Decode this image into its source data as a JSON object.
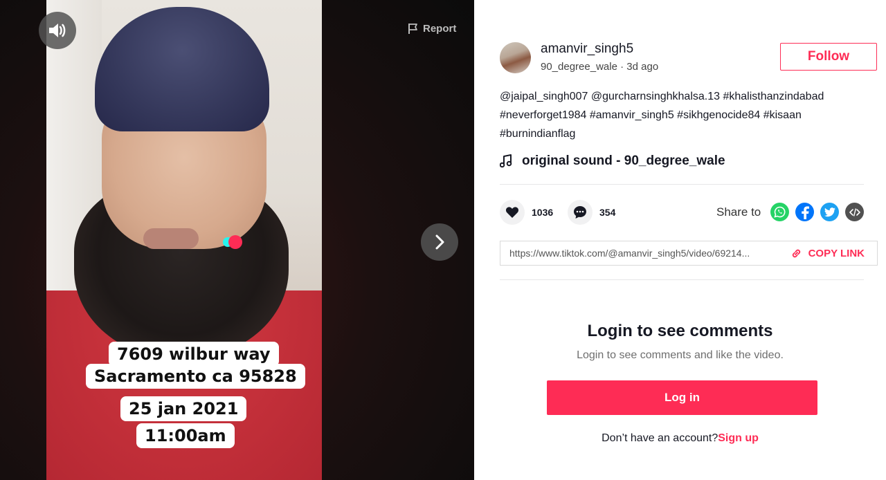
{
  "video": {
    "report_label": "Report",
    "overlay_lines": [
      "7609 wilbur way",
      "Sacramento ca 95828",
      "25 jan 2021",
      "11:00am"
    ]
  },
  "author": {
    "username": "amanvir_singh5",
    "nickname": "90_degree_wale",
    "separator": " · ",
    "posted": "3d ago"
  },
  "follow_label": "Follow",
  "description_lines": [
    "@jaipal_singh007 @gurcharnsinghkhalsa.13 #khalisthanzindabad",
    "#neverforget1984 #amanvir_singh5 #sikhgenocide84 #kisaan",
    "#burnindianflag"
  ],
  "music": "original sound - 90_degree_wale",
  "stats": {
    "likes": "1036",
    "comments": "354"
  },
  "share": {
    "label": "Share to",
    "icons": [
      "whatsapp-icon",
      "facebook-icon",
      "twitter-icon",
      "embed-icon"
    ],
    "colors": {
      "whatsapp": "#25d366",
      "facebook": "#0075fa",
      "twitter": "#1da1f2",
      "embed": "#515151"
    }
  },
  "link": {
    "url": "https://www.tiktok.com/@amanvir_singh5/video/69214...",
    "copy_label": "COPY LINK"
  },
  "login": {
    "title": "Login to see comments",
    "subtitle": "Login to see comments and like the video.",
    "button": "Log in",
    "prompt": "Don’t have an account?",
    "signup": "Sign up"
  },
  "colors": {
    "accent": "#fe2c55",
    "text": "#161823"
  }
}
